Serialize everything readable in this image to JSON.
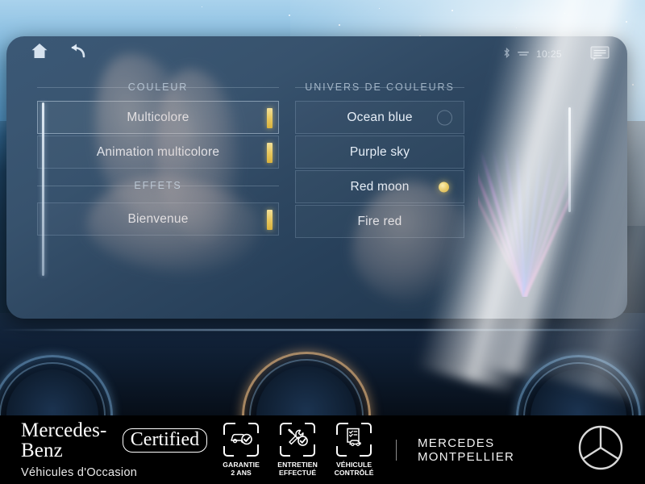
{
  "screen": {
    "nav": {
      "home_icon": "home-icon",
      "back_icon": "back-arrow-icon"
    },
    "status": {
      "bluetooth_icon": "bluetooth-icon",
      "signal_icon": "signal-icon",
      "time": "10:25",
      "message_icon": "message-bubble-icon"
    },
    "left_column": {
      "header_couleur": "COULEUR",
      "header_effets": "EFFETS",
      "color_items": [
        {
          "label": "Multicolore",
          "selected": true,
          "marker": "amber-bar"
        },
        {
          "label": "Animation multicolore",
          "selected": false,
          "marker": "amber-bar"
        }
      ],
      "effect_items": [
        {
          "label": "Bienvenue",
          "selected": false,
          "marker": "amber-bar"
        }
      ]
    },
    "right_column": {
      "header": "UNIVERS DE COULEURS",
      "items": [
        {
          "label": "Ocean blue",
          "indicator": "ring"
        },
        {
          "label": "Purple sky",
          "indicator": "none"
        },
        {
          "label": "Red moon",
          "indicator": "amber-dot"
        },
        {
          "label": "Fire red",
          "indicator": "none"
        }
      ]
    },
    "ambient_preview": "color-spectrum-fan"
  },
  "banner": {
    "brand_line1_a": "Mercedes-Benz",
    "brand_line1_b": "Certified",
    "brand_line2": "Véhicules d'Occasion",
    "badges": [
      {
        "icon": "car-check-icon",
        "line1": "GARANTIE",
        "line2": "2 ANS"
      },
      {
        "icon": "tools-check-icon",
        "line1": "ENTRETIEN",
        "line2": "EFFECTUÉ"
      },
      {
        "icon": "checklist-car-icon",
        "line1": "VÉHICULE",
        "line2": "CONTRÔLÉ"
      }
    ],
    "dealer": "MERCEDES MONTPELLIER",
    "logo_icon": "mercedes-star-logo"
  },
  "colors": {
    "amber": "#e8c85f",
    "screen_bg": "#33506d",
    "text": "#e6eef7",
    "banner_bg": "#000000"
  }
}
